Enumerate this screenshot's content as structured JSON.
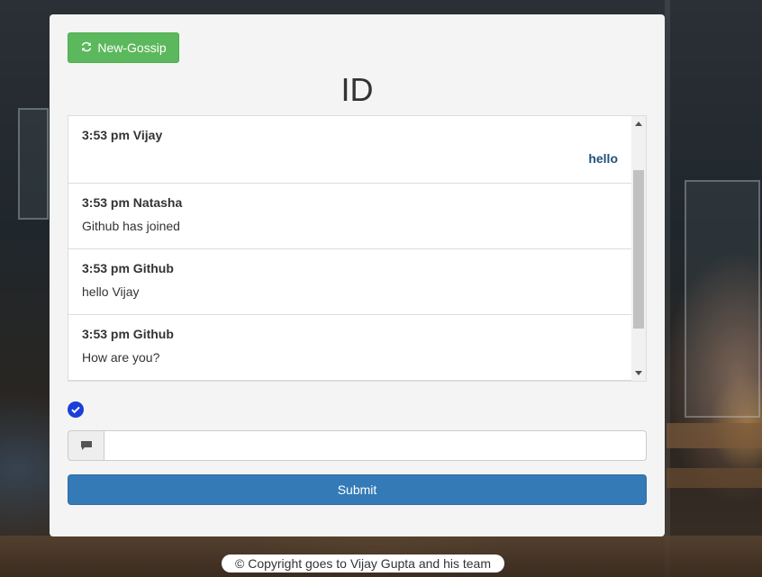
{
  "header": {
    "new_button_label": "New-Gossip",
    "title": "ID"
  },
  "messages": [
    {
      "time_user": "3:53 pm Vijay",
      "text": "hello",
      "own": true
    },
    {
      "time_user": "3:53 pm Natasha",
      "text": "Github has joined",
      "own": false
    },
    {
      "time_user": "3:53 pm Github",
      "text": "hello Vijay",
      "own": false
    },
    {
      "time_user": "3:53 pm Github",
      "text": "How are you?",
      "own": false
    }
  ],
  "composer": {
    "status_icon": "check-circle-icon",
    "addon_icon": "comment-icon",
    "value": "",
    "submit_label": "Submit"
  },
  "footer": {
    "text": "© Copyright goes to Vijay Gupta and his team"
  },
  "colors": {
    "new_button": "#5cb85c",
    "submit_button": "#337ab7",
    "own_message": "#23527c",
    "status_check": "#1a3fd8"
  }
}
